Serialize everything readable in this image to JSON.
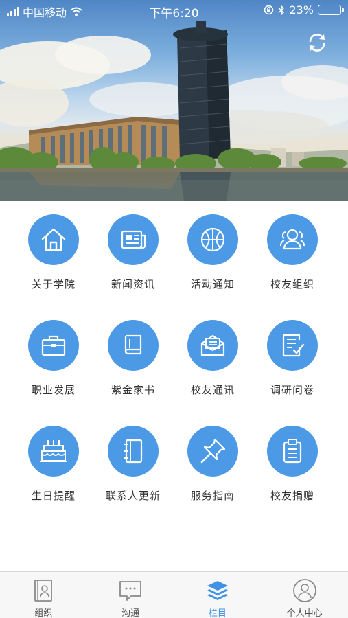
{
  "status_bar": {
    "carrier": "中国移动",
    "time": "下午6:20",
    "battery_percent": "23%",
    "battery_level": 0.23,
    "icons": [
      "signal-icon",
      "wifi-icon",
      "rotation-lock-icon",
      "bluetooth-icon",
      "battery-icon"
    ]
  },
  "banner": {
    "image": "campus-tower-lake-photo",
    "refresh_icon": "refresh-icon"
  },
  "colors": {
    "accent": "#4c9ae6",
    "tab_active": "#3e93e6",
    "tab_inactive": "#8a8a8a",
    "label_text": "#333333"
  },
  "menu": {
    "items": [
      {
        "label": "关于学院",
        "icon": "house-icon"
      },
      {
        "label": "新闻资讯",
        "icon": "newspaper-icon"
      },
      {
        "label": "活动通知",
        "icon": "basketball-icon"
      },
      {
        "label": "校友组织",
        "icon": "group-icon"
      },
      {
        "label": "职业发展",
        "icon": "briefcase-icon"
      },
      {
        "label": "紫金家书",
        "icon": "book-icon"
      },
      {
        "label": "校友通讯",
        "icon": "envelope-icon"
      },
      {
        "label": "调研问卷",
        "icon": "survey-icon"
      },
      {
        "label": "生日提醒",
        "icon": "cake-icon"
      },
      {
        "label": "联系人更新",
        "icon": "contact-book-icon"
      },
      {
        "label": "服务指南",
        "icon": "pushpin-icon"
      },
      {
        "label": "校友捐赠",
        "icon": "clipboard-icon"
      }
    ]
  },
  "tabbar": {
    "active": "栏目",
    "tabs": [
      {
        "label": "组织",
        "icon": "contact-card-icon"
      },
      {
        "label": "沟通",
        "icon": "chat-bubble-icon"
      },
      {
        "label": "栏目",
        "icon": "layers-icon"
      },
      {
        "label": "个人中心",
        "icon": "user-circle-icon"
      }
    ]
  }
}
